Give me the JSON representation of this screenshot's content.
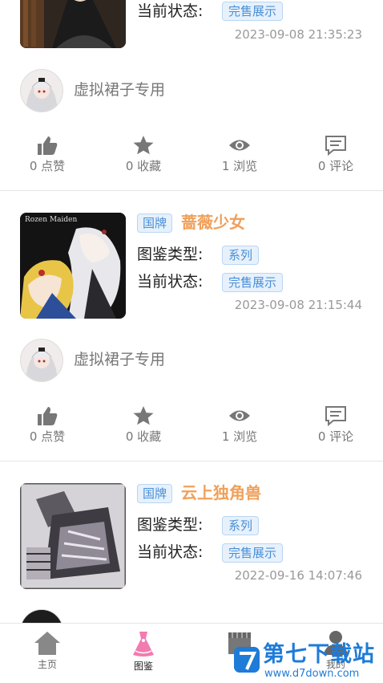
{
  "cards": [
    {
      "status_label": "当前状态:",
      "status_value": "完售展示",
      "date": "2023-09-08 21:35:23",
      "author": "虚拟裙子专用",
      "likes": "0 点赞",
      "favorites": "0 收藏",
      "views": "1 浏览",
      "comments": "0 评论"
    },
    {
      "brand": "国牌",
      "title": "蔷薇少女",
      "thumb_caption": "Rozen Maiden",
      "type_label": "图鉴类型:",
      "type_value": "系列",
      "status_label": "当前状态:",
      "status_value": "完售展示",
      "date": "2023-09-08 21:15:44",
      "author": "虚拟裙子专用",
      "likes": "0 点赞",
      "favorites": "0 收藏",
      "views": "1 浏览",
      "comments": "0 评论"
    },
    {
      "brand": "国牌",
      "title": "云上独角兽",
      "type_label": "图鉴类型:",
      "type_value": "系列",
      "status_label": "当前状态:",
      "status_value": "完售展示",
      "date": "2022-09-16 14:07:46"
    }
  ],
  "tabbar": {
    "home": "主页",
    "catalog": "图鉴",
    "mine": "我的"
  },
  "watermark": {
    "title": "第七下载站",
    "url": "www.d7down.com"
  },
  "colors": {
    "accent_title": "#f0a05a",
    "tag_blue": "#4a8fd6",
    "watermark_blue": "#1e7bd8"
  }
}
